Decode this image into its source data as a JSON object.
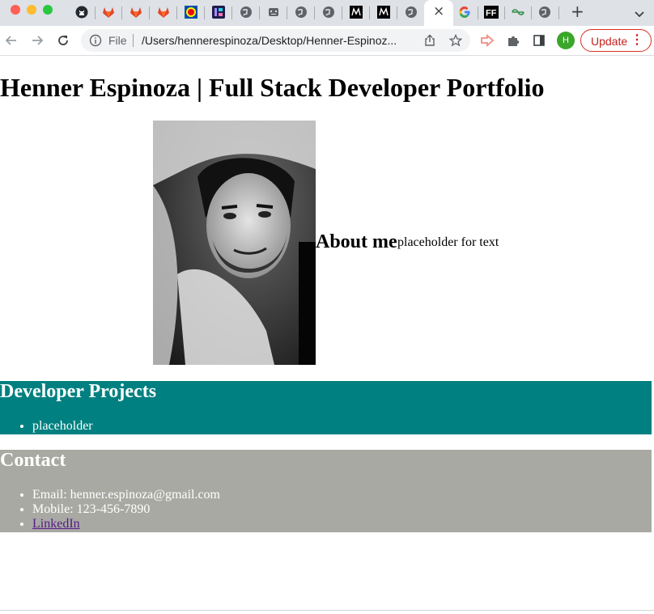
{
  "browser": {
    "tabs": [
      {
        "icon": "github-icon",
        "glyph": "●",
        "color": "#24292f"
      },
      {
        "icon": "gitlab-icon",
        "glyph": "▲",
        "color": "#e2432a"
      },
      {
        "icon": "gitlab-icon",
        "glyph": "▲",
        "color": "#e2432a"
      },
      {
        "icon": "gitlab-icon",
        "glyph": "▲",
        "color": "#e2432a"
      },
      {
        "icon": "lidl-icon",
        "glyph": "■",
        "color": "#0050aa"
      },
      {
        "icon": "app-tile-icon",
        "glyph": "■",
        "color": "#6a5acd"
      },
      {
        "icon": "globe-icon",
        "glyph": "◍",
        "color": "#5f6368"
      },
      {
        "icon": "robot-icon",
        "glyph": "▣",
        "color": "#5f6368"
      },
      {
        "icon": "globe-icon",
        "glyph": "◍",
        "color": "#5f6368"
      },
      {
        "icon": "globe-icon",
        "glyph": "◍",
        "color": "#5f6368"
      },
      {
        "icon": "medium-icon",
        "glyph": "M",
        "color": "#000000"
      },
      {
        "icon": "medium-icon",
        "glyph": "M",
        "color": "#000000"
      },
      {
        "icon": "globe-icon",
        "glyph": "◍",
        "color": "#5f6368"
      },
      {
        "icon": "google-icon",
        "glyph": "G",
        "color": "#4285f4"
      },
      {
        "icon": "ff-icon",
        "glyph": "FF",
        "color": "#000000"
      },
      {
        "icon": "gfg-icon",
        "glyph": "∞",
        "color": "#2f8d46"
      },
      {
        "icon": "globe-icon",
        "glyph": "◍",
        "color": "#5f6368"
      }
    ],
    "active_tab_close": "×",
    "new_tab": "+",
    "tab_menu": "⌄",
    "file_label": "File",
    "url": "/Users/hennerespinoza/Desktop/Henner-Espinoz...",
    "profile_initial": "H",
    "update_label": "Update",
    "menu_dots": "⋮",
    "colors": {
      "accent": "#1a73e8",
      "update_red": "#d93025",
      "profile_green": "#3aa62a"
    }
  },
  "page": {
    "title": "Henner Espinoza | Full Stack Developer Portfolio",
    "about": {
      "heading": "About me",
      "text": "placeholder for text"
    },
    "projects": {
      "heading": "Developer Projects",
      "items": [
        "placeholder"
      ],
      "bg_color": "#008080"
    },
    "contact": {
      "heading": "Contact",
      "email": "Email: henner.espinoza@gmail.com",
      "mobile": "Mobile: 123-456-7890",
      "linkedin": "LinkedIn",
      "bg_color": "#a9a9a3"
    }
  }
}
